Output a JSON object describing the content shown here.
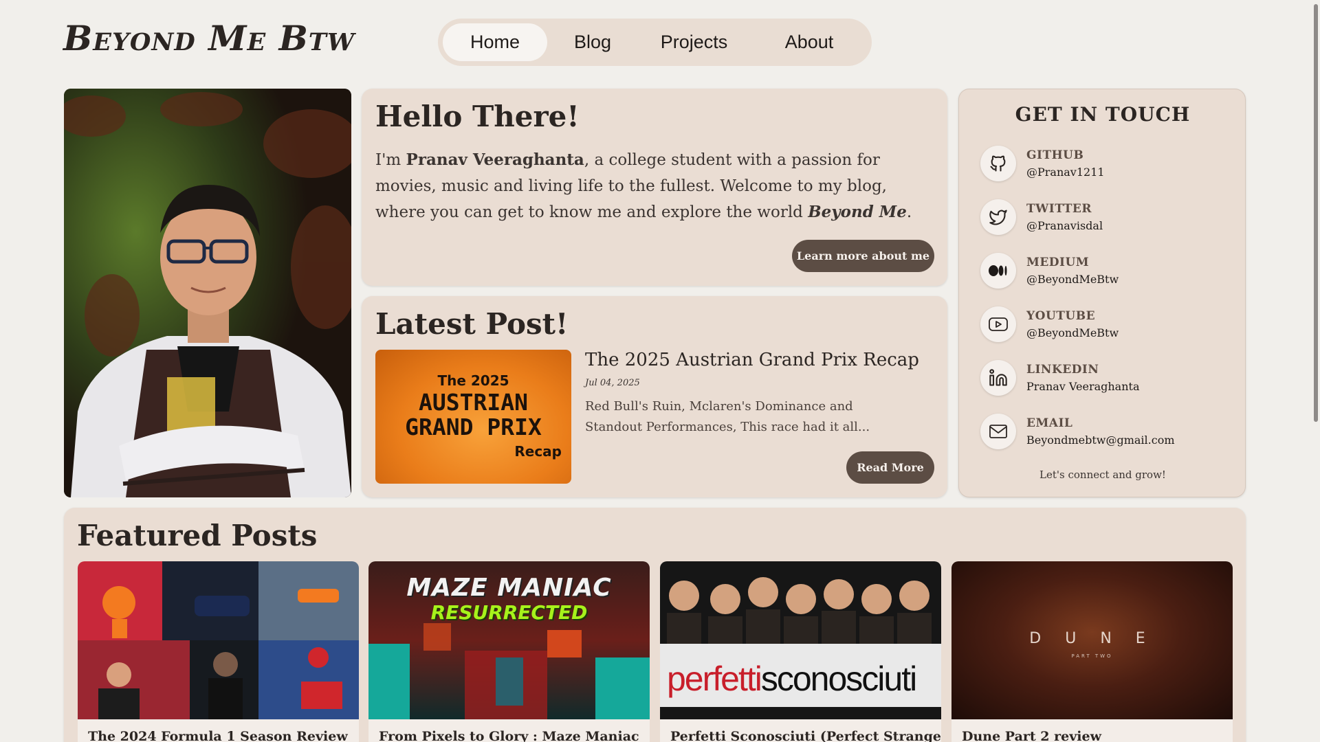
{
  "site": {
    "title": "Beyond Me Btw"
  },
  "nav": [
    {
      "label": "Home",
      "active": true
    },
    {
      "label": "Blog",
      "active": false
    },
    {
      "label": "Projects",
      "active": false
    },
    {
      "label": "About",
      "active": false
    }
  ],
  "hello": {
    "heading": "Hello There!",
    "intro_pre": "I'm ",
    "name": "Pranav Veeraghanta",
    "intro_mid": ", a college student with a passion for movies, music and living life to the fullest. Welcome to my blog, where you can get to know me and explore the world ",
    "tagline": "Beyond Me",
    "intro_end": ".",
    "button": "Learn more about me"
  },
  "latest": {
    "heading": "Latest Post!",
    "thumb_line1": "The 2025",
    "thumb_line2": "AUSTRIAN",
    "thumb_line3": "GRAND PRIX",
    "thumb_line4": "Recap",
    "title": "The 2025 Austrian Grand Prix Recap",
    "date": "Jul 04, 2025",
    "excerpt": "Red Bull's Ruin, Mclaren's Dominance and Standout Performances, This race had it all...",
    "button": "Read More"
  },
  "contact": {
    "heading": "GET IN TOUCH",
    "items": [
      {
        "label": "GITHUB",
        "handle": "@Pranav1211",
        "icon": "github-icon"
      },
      {
        "label": "TWITTER",
        "handle": "@Pranavisdal",
        "icon": "twitter-icon"
      },
      {
        "label": "MEDIUM",
        "handle": "@BeyondMeBtw",
        "icon": "medium-icon"
      },
      {
        "label": "YOUTUBE",
        "handle": "@BeyondMeBtw",
        "icon": "youtube-icon"
      },
      {
        "label": "LINKEDIN",
        "handle": "Pranav Veeraghanta",
        "icon": "linkedin-icon"
      },
      {
        "label": "EMAIL",
        "handle": "Beyondmebtw@gmail.com",
        "icon": "mail-icon"
      }
    ],
    "footer": "Let's connect and grow!"
  },
  "featured": {
    "heading": "Featured Posts",
    "posts": [
      {
        "title": "The 2024 Formula 1 Season Review"
      },
      {
        "title": "From Pixels to Glory : Maze Maniac",
        "img_line1": "MAZE MANIAC",
        "img_line2": "RESURRECTED"
      },
      {
        "title": "Perfetti Sconosciuti (Perfect Strangers)",
        "img_word1": "perfetti",
        "img_word2": "sconosciuti"
      },
      {
        "title": "Dune Part 2 review",
        "img_word1": "D U N E",
        "img_word2": "PART TWO"
      }
    ]
  },
  "colors": {
    "background": "#f1efeb",
    "card": "#eaddd3",
    "button": "#5c4d44",
    "text": "#2b2522"
  }
}
